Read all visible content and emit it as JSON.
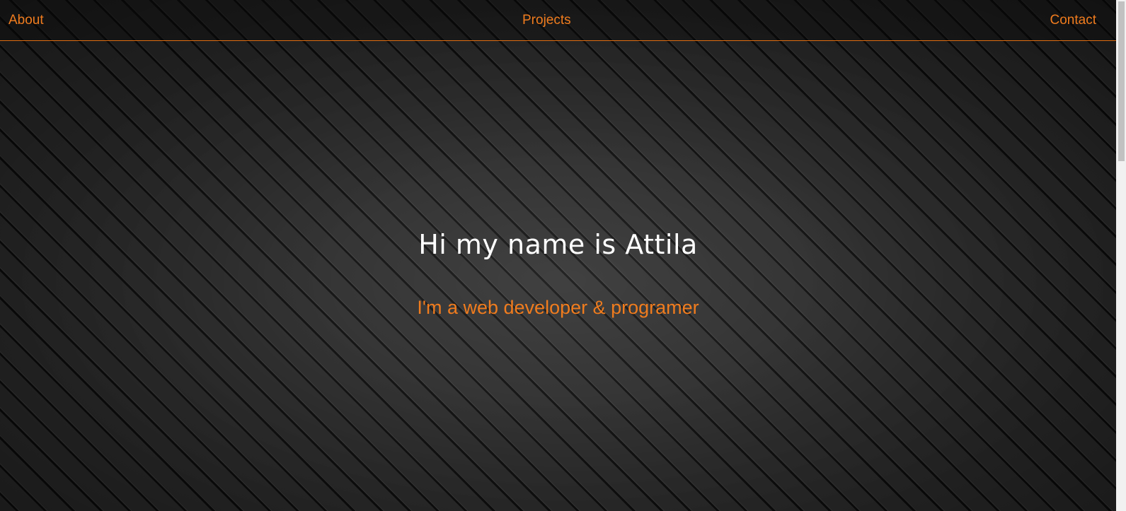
{
  "nav": {
    "about": "About",
    "projects": "Projects",
    "contact": "Contact"
  },
  "hero": {
    "title": "Hi my name is Attila",
    "subtitle": "I'm a web developer & programer"
  },
  "colors": {
    "accent": "#f07c1e",
    "title": "#ffffff",
    "background": "#1c1c1c"
  }
}
